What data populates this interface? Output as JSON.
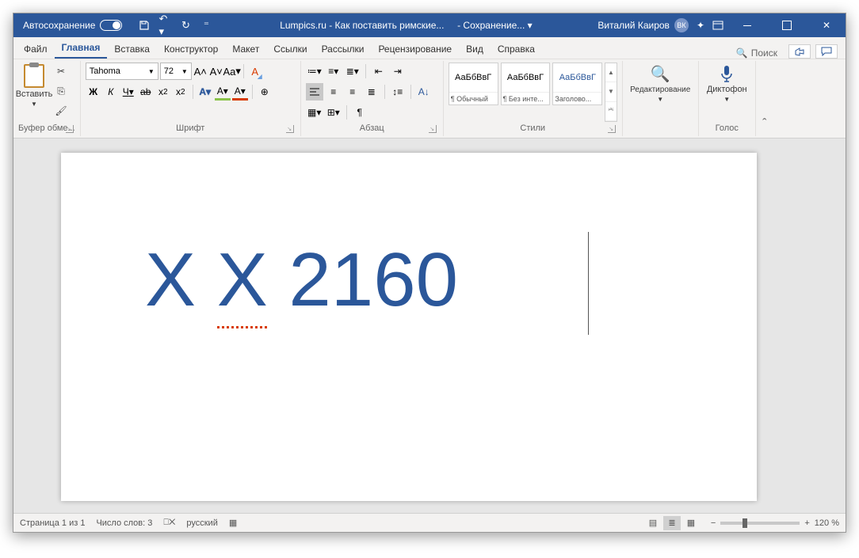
{
  "titlebar": {
    "autosave": "Автосохранение",
    "doc_title": "Lumpics.ru - Как поставить римские...",
    "saving": "- Сохранение...",
    "user_name": "Виталий Каиров",
    "user_initials": "ВК"
  },
  "tabs": {
    "file": "Файл",
    "home": "Главная",
    "insert": "Вставка",
    "design": "Конструктор",
    "layout": "Макет",
    "references": "Ссылки",
    "mailings": "Рассылки",
    "review": "Рецензирование",
    "view": "Вид",
    "help": "Справка",
    "search": "Поиск"
  },
  "clipboard": {
    "paste": "Вставить",
    "group": "Буфер обме..."
  },
  "font": {
    "name": "Tahoma",
    "size": "72",
    "group": "Шрифт",
    "bold": "Ж",
    "italic": "К",
    "underline": "Ч",
    "strike": "ab",
    "sub_x": "x",
    "sub_2": "2",
    "sup_x": "x",
    "sup_2": "2",
    "textfx": "A",
    "highlight": "A",
    "fontcolor": "A",
    "grow": "A˄",
    "shrink": "A˅",
    "case": "Aa",
    "clear": "A"
  },
  "para": {
    "group": "Абзац",
    "pilcrow": "¶"
  },
  "styles": {
    "group": "Стили",
    "preview": "АаБбВвГ",
    "normal": "¶ Обычный",
    "nospace": "¶ Без инте...",
    "heading": "Заголово..."
  },
  "editing": {
    "group": "Редактирование"
  },
  "voice": {
    "label": "Диктофон",
    "group": "Голос"
  },
  "document": {
    "word1": "X",
    "word2": "X",
    "word3": "2160"
  },
  "status": {
    "page": "Страница 1 из 1",
    "words": "Число слов: 3",
    "lang": "русский",
    "zoom": "120 %"
  }
}
